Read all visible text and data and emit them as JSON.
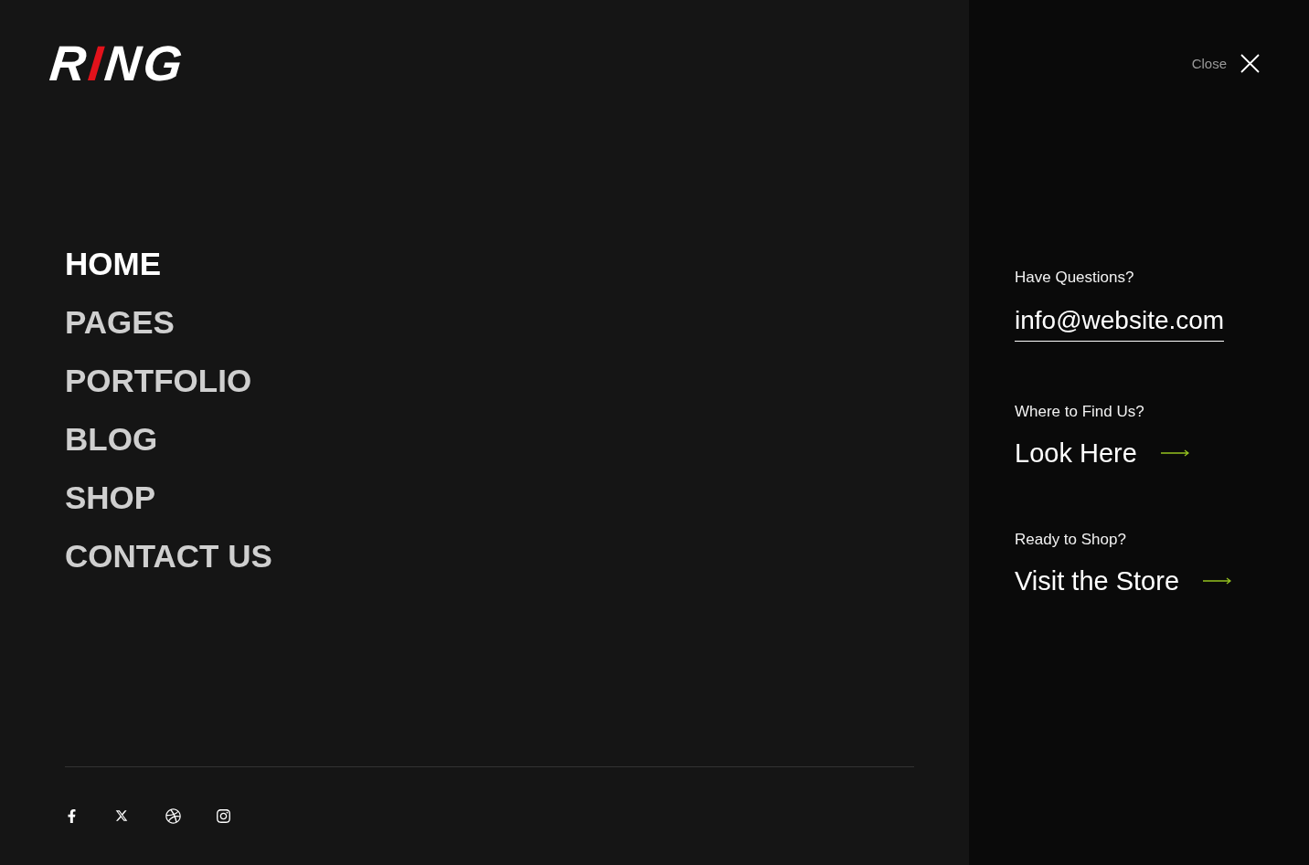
{
  "logo": {
    "parts": [
      {
        "text": "R",
        "color": "#ffffff"
      },
      {
        "text": "I",
        "color": "#e3121b"
      },
      {
        "text": "NG",
        "color": "#ffffff"
      }
    ]
  },
  "nav": {
    "items": [
      {
        "label": "HOME",
        "selected": true
      },
      {
        "label": "PAGES",
        "selected": false
      },
      {
        "label": "PORTFOLIO",
        "selected": false
      },
      {
        "label": "BLOG",
        "selected": false
      },
      {
        "label": "SHOP",
        "selected": false
      },
      {
        "label": "CONTACT US",
        "selected": false
      }
    ]
  },
  "close_button": {
    "label": "Close"
  },
  "contact_blocks": [
    {
      "kind": "email",
      "label": "Have Questions?",
      "value": "info@website.com"
    },
    {
      "kind": "link",
      "label": "Where to Find Us?",
      "value": "Look Here"
    },
    {
      "kind": "link",
      "label": "Ready to Shop?",
      "value": "Visit the Store"
    }
  ]
}
